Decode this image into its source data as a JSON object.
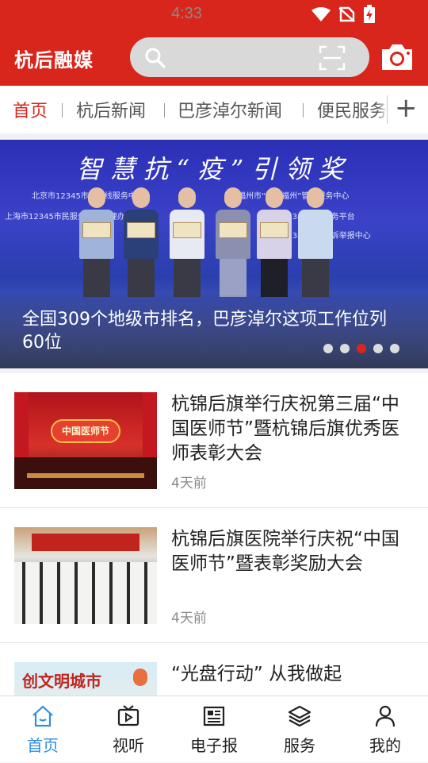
{
  "status_bar": {
    "time": "4:33"
  },
  "app": {
    "logo": "杭后融媒"
  },
  "search": {
    "placeholder": ""
  },
  "tabs": [
    {
      "label": "首页",
      "active": true
    },
    {
      "label": "杭后新闻",
      "active": false
    },
    {
      "label": "巴彦淖尔新闻",
      "active": false
    },
    {
      "label": "便民服务",
      "active": false
    }
  ],
  "banner": {
    "headline": "智慧抗“疫”引领奖",
    "sub_lines": [
      "北京市12345市民热线服务中心",
      "福州市“智慧福州”管理服务中心",
      "上海市12345市民服务热线管理办公室",
      "延安市12345政务服务平台",
      "台州市12345政府投诉举报中心"
    ],
    "caption": "全国309个地级市排名，巴彦淖尔这项工作位列60位",
    "dots": 5,
    "active_dot": 2
  },
  "news": [
    {
      "title": "杭锦后旗举行庆祝第三届“中国医师节”暨杭锦后旗优秀医师表彰大会",
      "time": "4天前",
      "thumb_text": "中国医师节"
    },
    {
      "title": "杭锦后旗医院举行庆祝“中国医师节”暨表彰奖励大会",
      "time": "4天前",
      "thumb_text": ""
    },
    {
      "title": "“光盘行动” 从我做起",
      "time": "",
      "thumb_text": "创文明城市"
    }
  ],
  "bottom_nav": [
    {
      "label": "首页",
      "icon": "home-icon",
      "active": true
    },
    {
      "label": "视听",
      "icon": "video-icon",
      "active": false
    },
    {
      "label": "电子报",
      "icon": "newspaper-icon",
      "active": false
    },
    {
      "label": "服务",
      "icon": "layers-icon",
      "active": false
    },
    {
      "label": "我的",
      "icon": "user-icon",
      "active": false
    }
  ],
  "colors": {
    "brand_red": "#d8261c",
    "nav_active_blue": "#2f8ee0"
  }
}
